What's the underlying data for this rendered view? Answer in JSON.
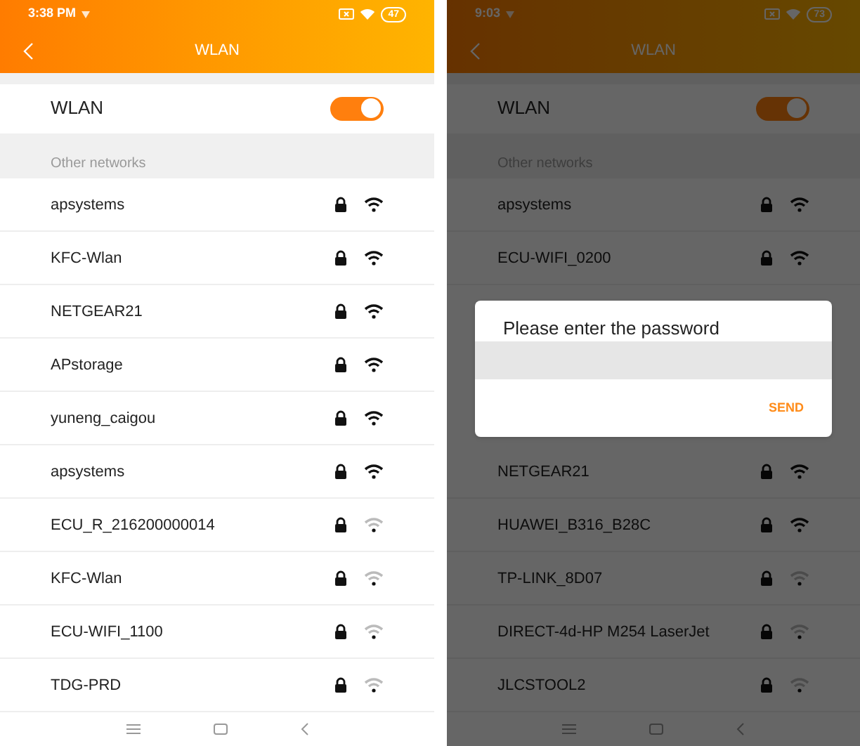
{
  "screens": [
    {
      "status": {
        "time": "3:38 PM",
        "battery": "47"
      },
      "title": "WLAN",
      "wlan": {
        "label": "WLAN",
        "on": true
      },
      "section": "Other networks",
      "list": [
        {
          "kind": "network",
          "name": "apsystems",
          "strong": true
        },
        {
          "kind": "network",
          "name": "KFC-Wlan",
          "strong": true
        },
        {
          "kind": "network",
          "name": "NETGEAR21",
          "strong": true
        },
        {
          "kind": "network",
          "name": "APstorage",
          "strong": true
        },
        {
          "kind": "network",
          "name": "yuneng_caigou",
          "strong": true
        },
        {
          "kind": "network",
          "name": "apsystems",
          "strong": true
        },
        {
          "kind": "network",
          "name": "ECU_R_216200000014",
          "strong": false
        },
        {
          "kind": "network",
          "name": "KFC-Wlan",
          "strong": false
        },
        {
          "kind": "network",
          "name": "ECU-WIFI_1100",
          "strong": false
        },
        {
          "kind": "network",
          "name": "TDG-PRD",
          "strong": false
        }
      ]
    },
    {
      "status": {
        "time": "9:03",
        "battery": "73"
      },
      "title": "WLAN",
      "dimmed": true,
      "wlan": {
        "label": "WLAN",
        "on": true
      },
      "section": "Other networks",
      "list": [
        {
          "kind": "network",
          "name": "apsystems",
          "strong": true
        },
        {
          "kind": "network",
          "name": "ECU-WIFI_0200",
          "strong": true
        },
        {
          "kind": "dialog",
          "title": "Please enter the password",
          "button": "SEND"
        },
        {
          "kind": "network",
          "name": "NETGEAR21",
          "strong": true
        },
        {
          "kind": "network",
          "name": "HUAWEI_B316_B28C",
          "strong": true
        },
        {
          "kind": "network",
          "name": "TP-LINK_8D07",
          "strong": false
        },
        {
          "kind": "network",
          "name": "DIRECT-4d-HP M254 LaserJet",
          "strong": false
        },
        {
          "kind": "network",
          "name": "JLCSTOOL2",
          "strong": false
        }
      ]
    }
  ]
}
